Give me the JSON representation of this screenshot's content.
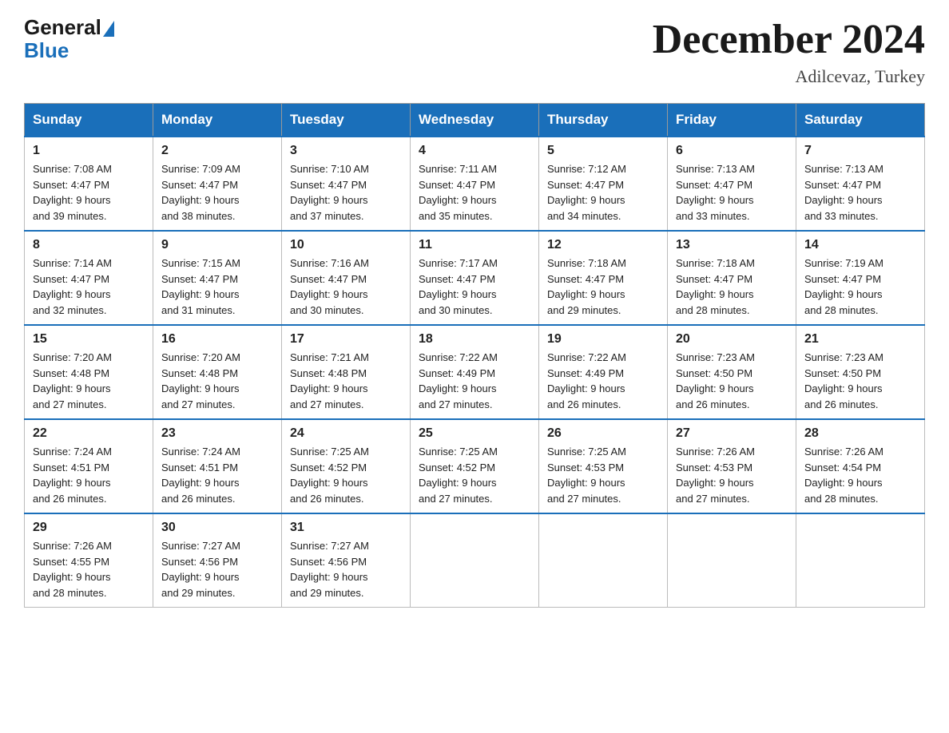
{
  "logo": {
    "general": "General",
    "blue": "Blue"
  },
  "header": {
    "month": "December 2024",
    "location": "Adilcevaz, Turkey"
  },
  "weekdays": [
    "Sunday",
    "Monday",
    "Tuesday",
    "Wednesday",
    "Thursday",
    "Friday",
    "Saturday"
  ],
  "weeks": [
    [
      {
        "day": "1",
        "sunrise": "7:08 AM",
        "sunset": "4:47 PM",
        "daylight": "9 hours and 39 minutes."
      },
      {
        "day": "2",
        "sunrise": "7:09 AM",
        "sunset": "4:47 PM",
        "daylight": "9 hours and 38 minutes."
      },
      {
        "day": "3",
        "sunrise": "7:10 AM",
        "sunset": "4:47 PM",
        "daylight": "9 hours and 37 minutes."
      },
      {
        "day": "4",
        "sunrise": "7:11 AM",
        "sunset": "4:47 PM",
        "daylight": "9 hours and 35 minutes."
      },
      {
        "day": "5",
        "sunrise": "7:12 AM",
        "sunset": "4:47 PM",
        "daylight": "9 hours and 34 minutes."
      },
      {
        "day": "6",
        "sunrise": "7:13 AM",
        "sunset": "4:47 PM",
        "daylight": "9 hours and 33 minutes."
      },
      {
        "day": "7",
        "sunrise": "7:13 AM",
        "sunset": "4:47 PM",
        "daylight": "9 hours and 33 minutes."
      }
    ],
    [
      {
        "day": "8",
        "sunrise": "7:14 AM",
        "sunset": "4:47 PM",
        "daylight": "9 hours and 32 minutes."
      },
      {
        "day": "9",
        "sunrise": "7:15 AM",
        "sunset": "4:47 PM",
        "daylight": "9 hours and 31 minutes."
      },
      {
        "day": "10",
        "sunrise": "7:16 AM",
        "sunset": "4:47 PM",
        "daylight": "9 hours and 30 minutes."
      },
      {
        "day": "11",
        "sunrise": "7:17 AM",
        "sunset": "4:47 PM",
        "daylight": "9 hours and 30 minutes."
      },
      {
        "day": "12",
        "sunrise": "7:18 AM",
        "sunset": "4:47 PM",
        "daylight": "9 hours and 29 minutes."
      },
      {
        "day": "13",
        "sunrise": "7:18 AM",
        "sunset": "4:47 PM",
        "daylight": "9 hours and 28 minutes."
      },
      {
        "day": "14",
        "sunrise": "7:19 AM",
        "sunset": "4:47 PM",
        "daylight": "9 hours and 28 minutes."
      }
    ],
    [
      {
        "day": "15",
        "sunrise": "7:20 AM",
        "sunset": "4:48 PM",
        "daylight": "9 hours and 27 minutes."
      },
      {
        "day": "16",
        "sunrise": "7:20 AM",
        "sunset": "4:48 PM",
        "daylight": "9 hours and 27 minutes."
      },
      {
        "day": "17",
        "sunrise": "7:21 AM",
        "sunset": "4:48 PM",
        "daylight": "9 hours and 27 minutes."
      },
      {
        "day": "18",
        "sunrise": "7:22 AM",
        "sunset": "4:49 PM",
        "daylight": "9 hours and 27 minutes."
      },
      {
        "day": "19",
        "sunrise": "7:22 AM",
        "sunset": "4:49 PM",
        "daylight": "9 hours and 26 minutes."
      },
      {
        "day": "20",
        "sunrise": "7:23 AM",
        "sunset": "4:50 PM",
        "daylight": "9 hours and 26 minutes."
      },
      {
        "day": "21",
        "sunrise": "7:23 AM",
        "sunset": "4:50 PM",
        "daylight": "9 hours and 26 minutes."
      }
    ],
    [
      {
        "day": "22",
        "sunrise": "7:24 AM",
        "sunset": "4:51 PM",
        "daylight": "9 hours and 26 minutes."
      },
      {
        "day": "23",
        "sunrise": "7:24 AM",
        "sunset": "4:51 PM",
        "daylight": "9 hours and 26 minutes."
      },
      {
        "day": "24",
        "sunrise": "7:25 AM",
        "sunset": "4:52 PM",
        "daylight": "9 hours and 26 minutes."
      },
      {
        "day": "25",
        "sunrise": "7:25 AM",
        "sunset": "4:52 PM",
        "daylight": "9 hours and 27 minutes."
      },
      {
        "day": "26",
        "sunrise": "7:25 AM",
        "sunset": "4:53 PM",
        "daylight": "9 hours and 27 minutes."
      },
      {
        "day": "27",
        "sunrise": "7:26 AM",
        "sunset": "4:53 PM",
        "daylight": "9 hours and 27 minutes."
      },
      {
        "day": "28",
        "sunrise": "7:26 AM",
        "sunset": "4:54 PM",
        "daylight": "9 hours and 28 minutes."
      }
    ],
    [
      {
        "day": "29",
        "sunrise": "7:26 AM",
        "sunset": "4:55 PM",
        "daylight": "9 hours and 28 minutes."
      },
      {
        "day": "30",
        "sunrise": "7:27 AM",
        "sunset": "4:56 PM",
        "daylight": "9 hours and 29 minutes."
      },
      {
        "day": "31",
        "sunrise": "7:27 AM",
        "sunset": "4:56 PM",
        "daylight": "9 hours and 29 minutes."
      },
      null,
      null,
      null,
      null
    ]
  ]
}
